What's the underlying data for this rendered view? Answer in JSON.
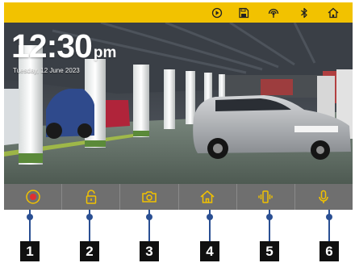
{
  "device": {
    "status_bar": {
      "background": "#f2c200",
      "icons": [
        "playback-icon",
        "save-icon",
        "signal-icon",
        "bluetooth-icon",
        "home-icon"
      ]
    },
    "screen": {
      "time": "12:30",
      "ampm": "pm",
      "date": "Tuesday, 12 June 2023"
    },
    "toolbar": {
      "background": "#6f6f6f",
      "accent": "#f2c200",
      "buttons": [
        {
          "icon": "record-icon"
        },
        {
          "icon": "unlock-icon"
        },
        {
          "icon": "camera-icon"
        },
        {
          "icon": "home-icon"
        },
        {
          "icon": "vibrate-phone-icon"
        },
        {
          "icon": "microphone-icon"
        }
      ]
    }
  },
  "callouts": [
    "1",
    "2",
    "3",
    "4",
    "5",
    "6"
  ],
  "colors": {
    "callout_line": "#2a4f93",
    "callout_badge": "#101010",
    "record_dot": "#e03030"
  }
}
